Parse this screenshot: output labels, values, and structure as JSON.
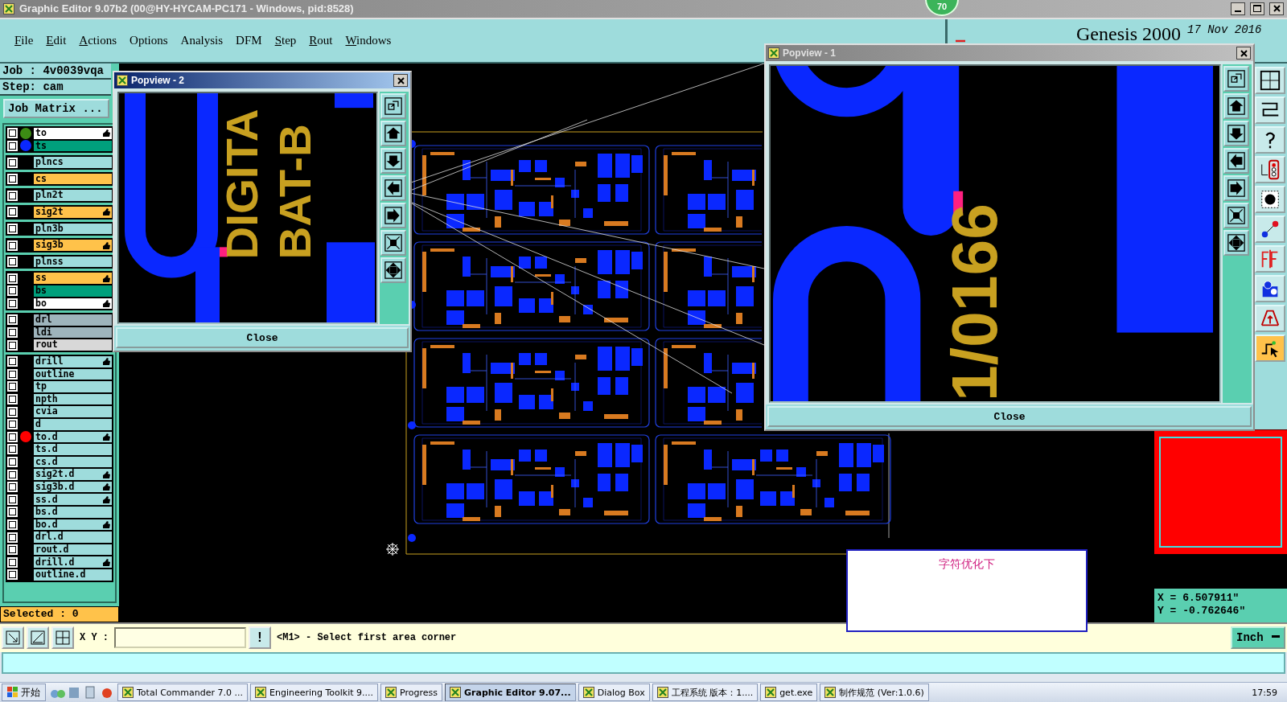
{
  "window": {
    "title": "Graphic Editor 9.07b2 (00@HY-HYCAM-PC171 - Windows, pid:8528)"
  },
  "badge": "70",
  "menu": [
    {
      "label": "File",
      "mnemonic": true
    },
    {
      "label": "Edit",
      "mnemonic": true
    },
    {
      "label": "Actions",
      "mnemonic": true
    },
    {
      "label": "Options",
      "mnemonic": false
    },
    {
      "label": "Analysis",
      "mnemonic": false
    },
    {
      "label": "DFM",
      "mnemonic": false
    },
    {
      "label": "Step",
      "mnemonic": true
    },
    {
      "label": "Rout",
      "mnemonic": true
    },
    {
      "label": "Windows",
      "mnemonic": true
    }
  ],
  "brand": {
    "product": "Genesis 2000",
    "date": "17 Nov 2016"
  },
  "job": {
    "job": "Job : 4v0039vqa",
    "step": "Step: cam",
    "matrix_button": "Job Matrix ..."
  },
  "layer_groups": [
    [
      {
        "name": "to",
        "kind": "silk",
        "color": "#3c8c14",
        "edit": true,
        "checked": false
      },
      {
        "name": "ts",
        "kind": "mask",
        "color": "#0a28ff",
        "edit": false,
        "checked": false
      }
    ],
    [
      {
        "name": "plncs",
        "kind": "plane",
        "edit": false,
        "checked": false
      }
    ],
    [
      {
        "name": "cs",
        "kind": "signal",
        "edit": false,
        "checked": false
      }
    ],
    [
      {
        "name": "pln2t",
        "kind": "plane",
        "edit": false,
        "checked": false
      }
    ],
    [
      {
        "name": "sig2t",
        "kind": "signal",
        "edit": true,
        "checked": false
      }
    ],
    [
      {
        "name": "pln3b",
        "kind": "plane",
        "edit": false,
        "checked": false
      }
    ],
    [
      {
        "name": "sig3b",
        "kind": "signal",
        "edit": true,
        "checked": false
      }
    ],
    [
      {
        "name": "plnss",
        "kind": "plane",
        "edit": false,
        "checked": false
      }
    ],
    [
      {
        "name": "ss",
        "kind": "signal",
        "edit": true,
        "checked": false
      },
      {
        "name": "bs",
        "kind": "mask",
        "edit": false,
        "checked": false
      },
      {
        "name": "bo",
        "kind": "silk",
        "edit": true,
        "checked": false
      }
    ],
    [
      {
        "name": "drl",
        "kind": "drill",
        "edit": false,
        "checked": false
      },
      {
        "name": "ldi",
        "kind": "drill",
        "edit": false,
        "checked": false
      },
      {
        "name": "rout",
        "kind": "rout",
        "edit": false,
        "checked": false
      }
    ],
    [
      {
        "name": "drill",
        "kind": "misc",
        "edit": true,
        "checked": false
      },
      {
        "name": "outline",
        "kind": "misc",
        "edit": false,
        "checked": false
      },
      {
        "name": "tp",
        "kind": "misc",
        "edit": false,
        "checked": false
      },
      {
        "name": "npth",
        "kind": "misc",
        "edit": false,
        "checked": false
      },
      {
        "name": "cvia",
        "kind": "misc",
        "edit": false,
        "checked": false
      },
      {
        "name": "d",
        "kind": "misc",
        "edit": false,
        "checked": false
      },
      {
        "name": "to.d",
        "kind": "misc",
        "color": "#ff0000",
        "edit": true,
        "checked": false
      },
      {
        "name": "ts.d",
        "kind": "misc",
        "edit": false,
        "checked": false
      },
      {
        "name": "cs.d",
        "kind": "misc",
        "edit": false,
        "checked": false
      },
      {
        "name": "sig2t.d",
        "kind": "misc",
        "edit": true,
        "checked": false
      },
      {
        "name": "sig3b.d",
        "kind": "misc",
        "edit": true,
        "checked": false
      },
      {
        "name": "ss.d",
        "kind": "misc",
        "edit": true,
        "checked": false
      },
      {
        "name": "bs.d",
        "kind": "misc",
        "edit": false,
        "checked": false
      },
      {
        "name": "bo.d",
        "kind": "misc",
        "edit": true,
        "checked": false
      },
      {
        "name": "drl.d",
        "kind": "misc",
        "edit": false,
        "checked": false
      },
      {
        "name": "rout.d",
        "kind": "misc",
        "edit": false,
        "checked": false
      },
      {
        "name": "drill.d",
        "kind": "misc",
        "edit": true,
        "checked": false
      },
      {
        "name": "outline.d",
        "kind": "misc",
        "edit": false,
        "checked": false
      }
    ]
  ],
  "selected": "Selected : 0",
  "popviews": [
    {
      "title": "Popview - 2",
      "active": true,
      "close": "Close",
      "labels": [
        "DIGITA",
        "BAT-B"
      ]
    },
    {
      "title": "Popview - 1",
      "active": false,
      "close": "Close",
      "labels": [
        "1/0166"
      ]
    }
  ],
  "note": {
    "text": "字符优化下"
  },
  "coords": {
    "x": "X = 6.507911\"",
    "y": "Y = -0.762646\""
  },
  "command": {
    "xy_label": "X Y :",
    "bang": "!",
    "prompt": "<M1> - Select first area corner",
    "units": "Inch"
  },
  "taskbar": {
    "start": "开始",
    "items": [
      {
        "label": "Total Commander 7.0 ...",
        "selected": false
      },
      {
        "label": "Engineering Toolkit 9....",
        "selected": false
      },
      {
        "label": "Progress",
        "selected": false
      },
      {
        "label": "Graphic Editor 9.07...",
        "selected": true
      },
      {
        "label": "Dialog Box",
        "selected": false
      },
      {
        "label": "工程系统  版本：1....",
        "selected": false
      },
      {
        "label": "get.exe",
        "selected": false
      },
      {
        "label": "制作规范 (Ver:1.0.6)",
        "selected": false
      }
    ],
    "clock": "17:59"
  }
}
